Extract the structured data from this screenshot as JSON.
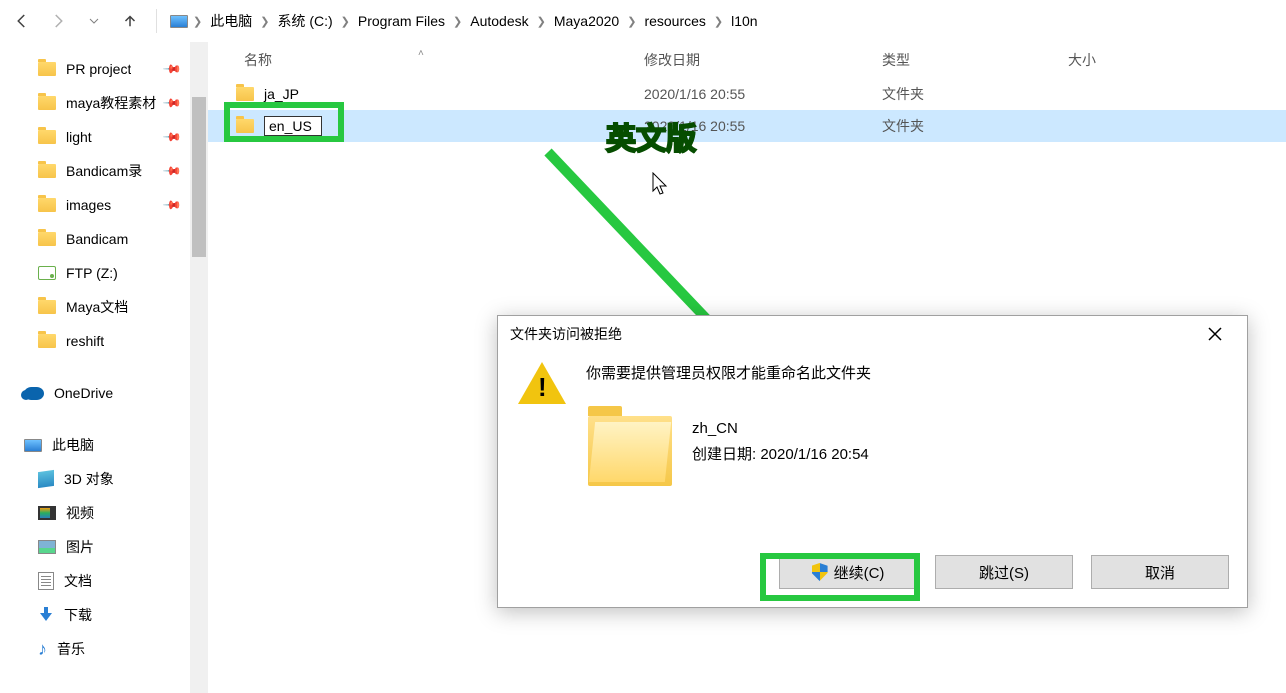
{
  "breadcrumb": {
    "items": [
      "此电脑",
      "系统 (C:)",
      "Program Files",
      "Autodesk",
      "Maya2020",
      "resources",
      "l10n"
    ]
  },
  "sidebar": {
    "quick": [
      {
        "label": "PR project",
        "pinned": true
      },
      {
        "label": "maya教程素材",
        "pinned": true
      },
      {
        "label": "light",
        "pinned": true
      },
      {
        "label": "Bandicam录",
        "pinned": true
      },
      {
        "label": "images",
        "pinned": true
      },
      {
        "label": "Bandicam",
        "pinned": false
      },
      {
        "label": "FTP (Z:)",
        "pinned": false,
        "type": "drive"
      },
      {
        "label": "Maya文档",
        "pinned": false
      },
      {
        "label": "reshift",
        "pinned": false
      }
    ],
    "onedrive": "OneDrive",
    "thispc": "此电脑",
    "pc_items": [
      {
        "label": "3D 对象",
        "icon": "cube"
      },
      {
        "label": "视频",
        "icon": "vid"
      },
      {
        "label": "图片",
        "icon": "pic"
      },
      {
        "label": "文档",
        "icon": "doc"
      },
      {
        "label": "下载",
        "icon": "dl"
      },
      {
        "label": "音乐",
        "icon": "music"
      }
    ]
  },
  "columns": {
    "name": "名称",
    "date": "修改日期",
    "type": "类型",
    "size": "大小"
  },
  "rows": [
    {
      "name": "ja_JP",
      "date": "2020/1/16 20:55",
      "type": "文件夹"
    },
    {
      "name": "en_US",
      "date": "2020/1/16 20:55",
      "type": "文件夹",
      "renaming": true
    }
  ],
  "annotation": "英文版",
  "dialog": {
    "title": "文件夹访问被拒绝",
    "message": "你需要提供管理员权限才能重命名此文件夹",
    "folder_name": "zh_CN",
    "created_label": "创建日期: 2020/1/16 20:54",
    "continue": "继续(C)",
    "skip": "跳过(S)",
    "cancel": "取消"
  }
}
